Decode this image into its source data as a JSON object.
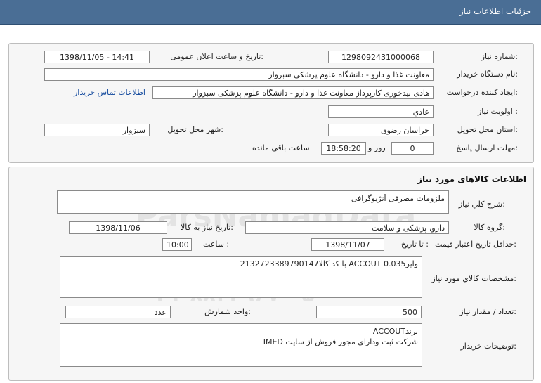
{
  "header": {
    "title": "جزئیات اطلاعات نیاز"
  },
  "info": {
    "need_number_label": "شماره نیاز:",
    "need_number": "1298092431000068",
    "announce_label": "تاریخ و ساعت اعلان عمومی:",
    "announce_value": "1398/11/05 - 14:41",
    "buyer_org_label": "نام دستگاه خریدار:",
    "buyer_org": "معاونت غذا و دارو - دانشگاه علوم پزشکی سبزوار",
    "creator_label": "ایجاد کننده درخواست:",
    "creator": "هادی بیدخوری کارپرداز معاونت غذا و دارو - دانشگاه علوم پزشکی سبزوار",
    "contact_link": "اطلاعات تماس خریدار",
    "priority_label": "اولویت نیاز :",
    "priority": "عادي",
    "province_label": "استان محل تحویل:",
    "province": "خراسان رضوی",
    "city_label": "شهر محل تحویل:",
    "city": "سبزوار",
    "deadline_label": "مهلت ارسال پاسخ:",
    "days": "0",
    "days_label": "روز و",
    "time": "18:58:20",
    "time_suffix": "ساعت باقی مانده"
  },
  "goods": {
    "section_title": "اطلاعات کالاهای مورد نیاز",
    "desc_label": "شرح کلي نیاز:",
    "desc": "ملزومات مصرفی آنژیوگرافی",
    "group_label": "گروه کالا:",
    "group": "دارو، پزشکی و سلامت",
    "need_date_label": "تاریخ نیاز به کالا:",
    "need_date": "1398/11/06",
    "min_price_label": "حداقل تاریخ اعتبار قیمت:",
    "until_date_label": "تا تاریخ :",
    "until_date": "1398/11/07",
    "hour_label": "ساعت :",
    "hour": "10:00",
    "spec_label": "مشخصات کالاي مورد نیاز:",
    "spec": "وایر0.035 ACCOUT با کد کالا2132723389790147",
    "qty_label": "تعداد / مقدار نیاز:",
    "qty": "500",
    "unit_label": "واحد شمارش:",
    "unit": "عدد",
    "buyer_notes_label": "توضیحات خریدار:",
    "buyer_notes_line1": "برندACCOUT",
    "buyer_notes_line2": "شرکت ثبت ودارای مجوز فروش از سایت IMED"
  },
  "watermark": {
    "brand": "ParsNamadData",
    "line1": "پایگاه اطلاع رسانی مناقصه و مزایده",
    "phone": "۰۲۱-۸۸۳۴۹۶۷۰-۵"
  }
}
